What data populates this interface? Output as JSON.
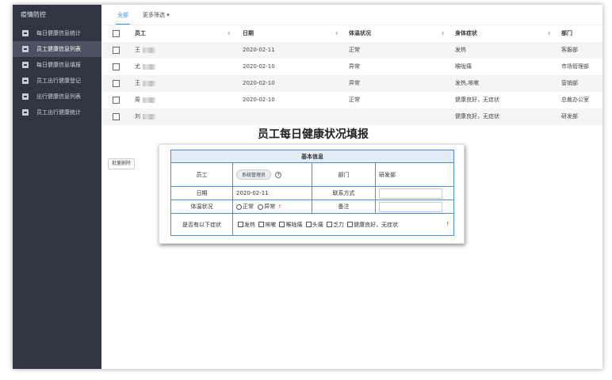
{
  "sidebar": {
    "title": "疫情防控",
    "items": [
      {
        "label": "每日健康信息统计",
        "active": false
      },
      {
        "label": "员工健康信息列表",
        "active": true
      },
      {
        "label": "每日健康信息填报",
        "active": false
      },
      {
        "label": "员工出行健康登记",
        "active": false
      },
      {
        "label": "出行健康信息列表",
        "active": false
      },
      {
        "label": "员工出行健康统计",
        "active": false
      }
    ]
  },
  "filters": {
    "all": "全部",
    "more": "更多筛选 ▾"
  },
  "table": {
    "headers": {
      "employee": "员工",
      "date": "日期",
      "temperature": "体温状况",
      "symptoms": "身体症状",
      "department": "部门"
    },
    "rows": [
      {
        "name": "王",
        "date": "2020-02-11",
        "temperature": "正常",
        "symptoms": "发热",
        "department": "客服部"
      },
      {
        "name": "尤",
        "date": "2020-02-10",
        "temperature": "异常",
        "symptoms": "喉咙痛",
        "department": "市场管理部"
      },
      {
        "name": "王",
        "date": "2020-02-10",
        "temperature": "异常",
        "symptoms": "发热,咳嗽",
        "department": "营销部"
      },
      {
        "name": "周",
        "date": "2020-02-10",
        "temperature": "正常",
        "symptoms": "健康良好，无症状",
        "department": "总裁办公室"
      },
      {
        "name": "刘",
        "date": "",
        "temperature": "",
        "symptoms": "健康良好，无症状",
        "department": "研发部"
      }
    ],
    "batch_delete": "批量删除"
  },
  "form": {
    "title": "员工每日健康状况填报",
    "section": "基本信息",
    "employee_label": "员工",
    "employee_value": "系统管理员",
    "department_label": "部门",
    "department_value": "研发部",
    "date_label": "日期",
    "date_value": "2020-02-11",
    "contact_label": "联系方式",
    "temp_label": "体温状况",
    "temp_normal": "正常",
    "temp_abnormal": "异常",
    "note_label": "备注",
    "symptom_label": "是否有以下症状",
    "symptom_options": [
      "发热",
      "咳嗽",
      "喉咙痛",
      "头痛",
      "乏力",
      "健康良好，无症状"
    ],
    "required_mark": "!"
  },
  "colors": {
    "sidebar_bg": "#2f3541",
    "accent": "#3c8be8",
    "form_border": "#4a90d9"
  }
}
